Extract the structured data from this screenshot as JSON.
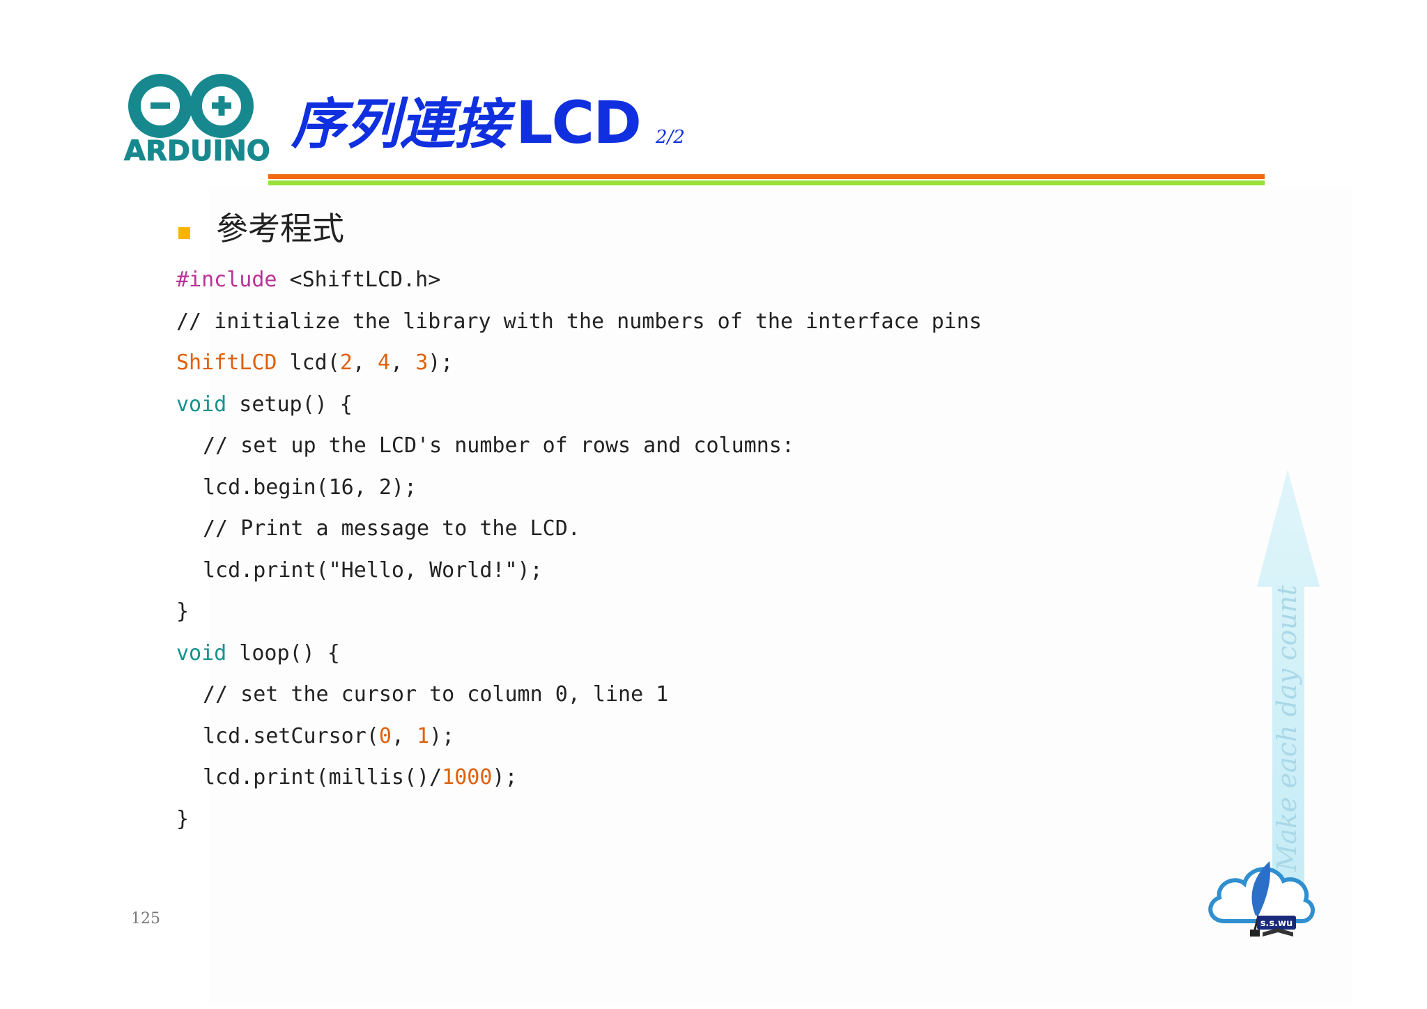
{
  "logo": {
    "text": "ARDUINO",
    "color": "#17898e"
  },
  "header": {
    "title_cjk": "序列連接",
    "title_lcd": "LCD",
    "page_indicator": "2/2",
    "title_color": "#1030e0"
  },
  "section": {
    "heading": "參考程式"
  },
  "code": {
    "include_keyword": "#include",
    "include_file": " <ShiftLCD.h>",
    "comment_init": "// initialize the library with the numbers of the interface pins",
    "shiftlcd_type": "ShiftLCD",
    "shiftlcd_ctor": " lcd(",
    "arg_a": "2",
    "sep_a": ", ",
    "arg_b": "4",
    "sep_b": ", ",
    "arg_c": "3",
    "ctor_end": ");",
    "setup_kw": "void",
    "setup_sig": " setup() {",
    "comment_setup": "// set up the LCD's number of rows and columns:",
    "begin_call": "lcd.begin(16, 2);",
    "comment_print": "// Print a message to the LCD.",
    "print_call": "lcd.print(\"Hello, World!\");",
    "close_brace_1": "}",
    "loop_kw": "void",
    "loop_sig": " loop() {",
    "comment_cursor": "// set the cursor to column 0, line 1",
    "cursor_pre": "lcd.setCursor(",
    "cursor_a": "0",
    "cursor_sep": ", ",
    "cursor_b": "1",
    "cursor_end": ");",
    "millis_pre": "lcd.print(millis()/",
    "millis_num": "1000",
    "millis_end": ");",
    "close_brace_2": "}"
  },
  "footer": {
    "page_number": "125",
    "motto": "Make each day count",
    "author_logo_text": "s.s.wu"
  },
  "colors": {
    "rule_orange": "#f0690f",
    "rule_green": "#99e03a",
    "bullet": "#f7b500",
    "keyword_teal": "#16918d",
    "number_orange": "#e0600c",
    "preprocessor_magenta": "#b83396"
  }
}
